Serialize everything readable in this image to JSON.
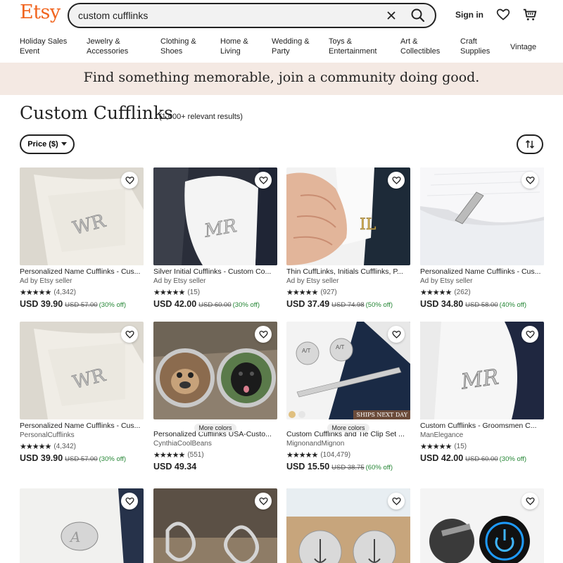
{
  "header": {
    "logo": "Etsy",
    "search_value": "custom cufflinks",
    "signin": "Sign in"
  },
  "nav": [
    {
      "label": "Holiday Sales\nEvent"
    },
    {
      "label": "Jewelry &\nAccessories"
    },
    {
      "label": "Clothing &\nShoes"
    },
    {
      "label": "Home &\nLiving"
    },
    {
      "label": "Wedding &\nParty"
    },
    {
      "label": "Toys &\nEntertainment"
    },
    {
      "label": "Art &\nCollectibles"
    },
    {
      "label": "Craft\nSupplies"
    },
    {
      "label": "Vintage"
    }
  ],
  "banner": "Find something memorable, join a community doing good.",
  "page": {
    "title": "Custom Cufflinks",
    "results": "(1,000+ relevant results)",
    "price_filter": "Price ($)"
  },
  "colors": {
    "accent": "#f1641e",
    "banner_bg": "#f4e9e3",
    "discount": "#258635"
  },
  "listings": [
    {
      "title": "Personalized Name Cufflinks - Cus...",
      "seller": "Ad by Etsy seller",
      "reviews": "(4,342)",
      "price": "USD 39.90",
      "orig": "USD 57.00",
      "off": "(30% off)"
    },
    {
      "title": "Silver Initial Cufflinks - Custom Co...",
      "seller": "Ad by Etsy seller",
      "reviews": "(15)",
      "price": "USD 42.00",
      "orig": "USD 60.00",
      "off": "(30% off)"
    },
    {
      "title": "Thin CuffLinks, Initials Cufflinks, P...",
      "seller": "Ad by Etsy seller",
      "reviews": "(927)",
      "price": "USD 37.49",
      "orig": "USD 74.98",
      "off": "(50% off)"
    },
    {
      "title": "Personalized Name Cufflinks - Cus...",
      "seller": "Ad by Etsy seller",
      "reviews": "(262)",
      "price": "USD 34.80",
      "orig": "USD 58.00",
      "off": "(40% off)"
    },
    {
      "title": "Personalized Name Cufflinks - Cus...",
      "seller": "PersonalCufflinks",
      "reviews": "(4,342)",
      "price": "USD 39.90",
      "orig": "USD 57.00",
      "off": "(30% off)"
    },
    {
      "title": "Personalized Cufflinks USA-Custo...",
      "seller": "CynthiaCoolBeans",
      "reviews": "(551)",
      "price": "USD 49.34",
      "orig": "",
      "off": "",
      "more_colors": "More colors"
    },
    {
      "title": "Custom Cufflinks and Tie Clip Set ...",
      "seller": "MignonandMignon",
      "reviews": "(104,479)",
      "price": "USD 15.50",
      "orig": "USD 38.75",
      "off": "(60% off)",
      "more_colors": "More colors",
      "badge": "SHIPS NEXT DAY"
    },
    {
      "title": "Custom Cufflinks - Groomsmen C...",
      "seller": "ManElegance",
      "reviews": "(15)",
      "price": "USD 42.00",
      "orig": "USD 60.00",
      "off": "(30% off)"
    }
  ],
  "stars": "★★★★★"
}
